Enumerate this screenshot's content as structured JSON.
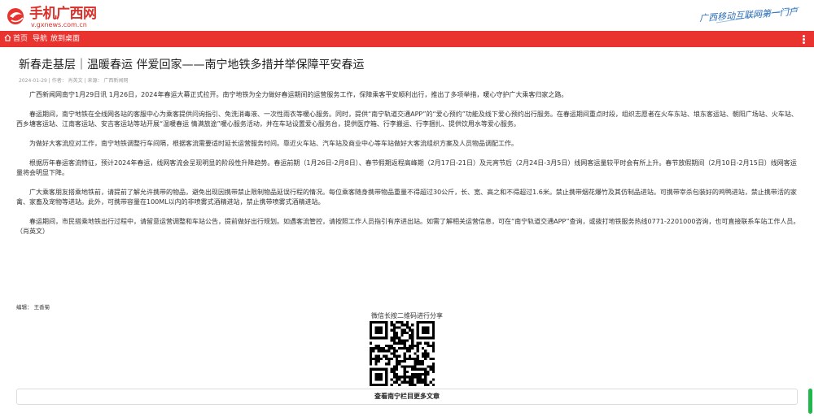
{
  "header": {
    "logo_title": "手机广西网",
    "logo_url": "v.gxnews.com.cn",
    "slogan": "广西移动互联网第一门户",
    "brand_color": "#e9332f"
  },
  "nav": {
    "home": "首页",
    "guide": "导航",
    "desktop": "放到桌面"
  },
  "article": {
    "title": "新春走基层｜温暖春运 伴爱回家——南宁地铁多措并举保障平安春运",
    "meta": "2024-01-29 | 作者： 肖英文 | 来源： 广西新闻网",
    "paragraphs": [
      "广西新闻网南宁1月29日讯 1月26日，2024年春运大幕正式拉开。南宁地铁为全力做好春运期间的运营服务工作，保障乘客平安顺利出行，推出了多项举措，暖心守护广大乘客归家之路。",
      "春运期间，南宁地铁在全线网各站的客服中心为乘客提供问询指引、免洗消毒液、一次性雨衣等暖心服务。同时，提供“南宁轨道交通APP”的“爱心预约”功能及线下爱心预约出行服务。在春运期间重点时段，组织志愿者在火车东站、埌东客运站、朝阳广场站、火车站、西乡塘客运站、江南客运站、安吉客运站等站开展“温暖春运 情满旅途”暖心服务活动，并在车站设置爱心服务台，提供医疗箱、行李搬运、行李捆扎、提供饮用水等爱心服务。",
      "为做好大客流应对工作，南宁地铁调整行车间隔，根据客流需要适时延长运营服务时间。靠近火车站、汽车站及商业中心等车站做好大客流组织方案及人员物品调配工作。",
      "根据历年春运客流特征，预计2024年春运，线网客流会呈现明显的阶段性升降趋势。春运前期（1月26日-2月8日）、春节假期返程高峰期（2月17日-21日）及元宵节后（2月24日-3月5日）线网客运量较平时会有所上升。春节放假期间（2月10日-2月15日）线网客运量将会明显下降。",
      "广大乘客朋友搭乘地铁前，请提前了解允许携带的物品，避免出现因携带禁止限制物品延误行程的情况。每位乘客随身携带物品重量不得超过30公斤，长、宽、高之和不得超过1.6米。禁止携带烟花爆竹及其仿制品进站。可携带宰杀包装好的鸡鸭进站，禁止携带活的家禽、家畜及宠物等进站。此外，可携带容量在100ML以内的非喷雾式酒精进站，禁止携带喷雾式酒精进站。",
      "春运期间，市民搭乘地铁出行过程中，请留意运营调整和车站公告，提前做好出行规划。如遇客流管控，请按照工作人员指引有序进出站。如需了解相关运营信息，可在“南宁轨道交通APP”查询，或拨打地铁服务热线0771-2201000咨询，也可直接联系车站工作人员。（肖英文）"
    ],
    "editor": "编辑： 王香菊"
  },
  "share": {
    "label": "微信长按二维码进行分享"
  },
  "more": {
    "label": "查看南宁栏目更多文章"
  }
}
